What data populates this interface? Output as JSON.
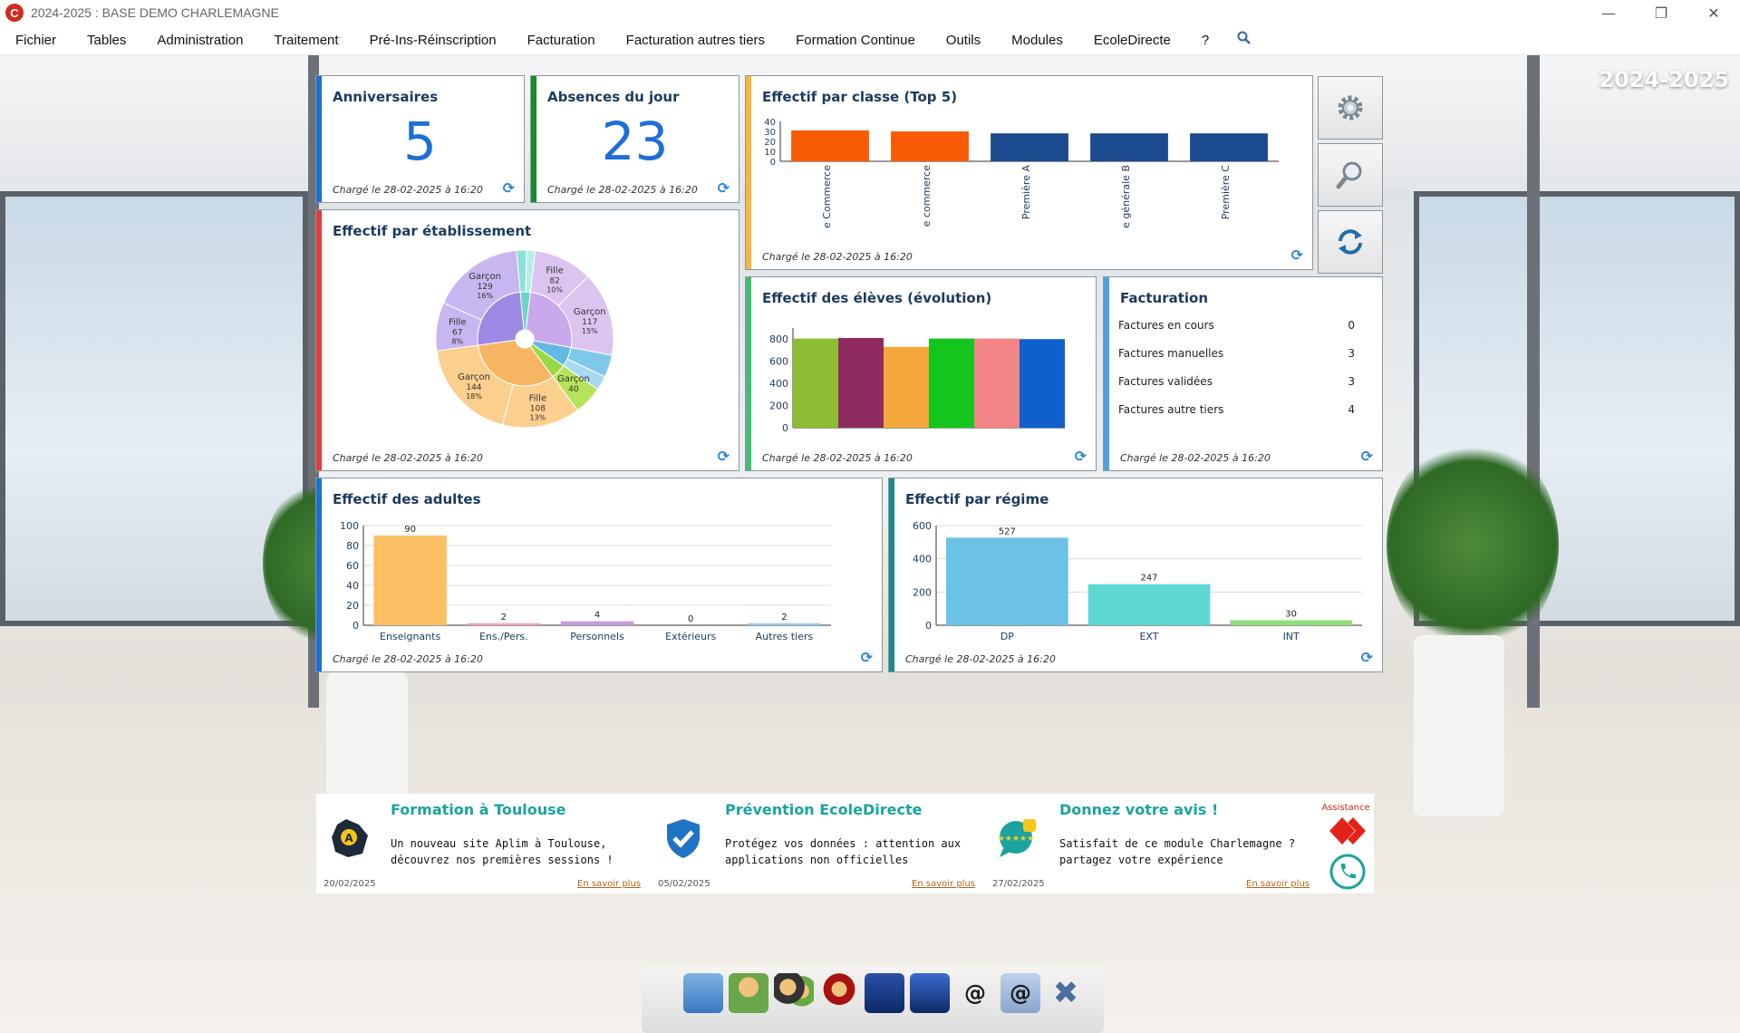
{
  "window": {
    "title": "2024-2025  :  BASE DEMO CHARLEMAGNE",
    "logo_letter": "C",
    "controls": {
      "minimize": "—",
      "restore": "❐",
      "close": "✕"
    }
  },
  "menu": [
    "Fichier",
    "Tables",
    "Administration",
    "Traitement",
    "Pré-Ins-Réinscription",
    "Facturation",
    "Facturation autres tiers",
    "Formation Continue",
    "Outils",
    "Modules",
    "EcoleDirecte",
    "?"
  ],
  "year_label": "2024-2025",
  "loaded_text": "Chargé le 28-02-2025 à 16:20",
  "refresh_glyph": "⟳",
  "widgets": {
    "anniversaires": {
      "title": "Anniversaires",
      "value": "5",
      "accent": "#1f6fd1"
    },
    "absences": {
      "title": "Absences du jour",
      "value": "23",
      "accent": "#1a8a2a"
    },
    "effectif_classe": {
      "title": "Effectif par classe (Top 5)",
      "accent": "#f6b73c"
    },
    "effectif_etab": {
      "title": "Effectif par établissement",
      "accent": "#e23c3c"
    },
    "evolution": {
      "title": "Effectif des élèves (évolution)",
      "accent": "#3fbf6f"
    },
    "facturation": {
      "title": "Facturation",
      "accent": "#4aa3e0",
      "rows": [
        {
          "label": "Factures en cours",
          "value": "0"
        },
        {
          "label": "Factures manuelles",
          "value": "3"
        },
        {
          "label": "Factures validées",
          "value": "3"
        },
        {
          "label": "Factures autre tiers",
          "value": "4"
        }
      ]
    },
    "adultes": {
      "title": "Effectif des adultes",
      "accent": "#1f6fd1"
    },
    "regime": {
      "title": "Effectif par régime",
      "accent": "#1a8a8a"
    }
  },
  "chart_data": [
    {
      "type": "bar",
      "title": "Effectif par classe (Top 5)",
      "categories": [
        "e Commerce",
        "e commerce",
        "Première A",
        "e générale B",
        "Première C"
      ],
      "values": [
        31,
        30,
        28,
        28,
        28
      ],
      "colors": [
        "#f95a04",
        "#f95a04",
        "#1c4a8e",
        "#1c4a8e",
        "#1c4a8e"
      ],
      "ylim": [
        0,
        40
      ],
      "yticks": [
        0,
        10,
        20,
        30,
        40
      ]
    },
    {
      "type": "bar",
      "title": "Effectif des élèves (évolution)",
      "categories": [
        "",
        "",
        "",
        "",
        "",
        ""
      ],
      "values": [
        805,
        810,
        730,
        805,
        805,
        800
      ],
      "colors": [
        "#8dbd32",
        "#8f2b5e",
        "#f5a83a",
        "#14c51e",
        "#f28485",
        "#0f5fcc"
      ],
      "ylim": [
        0,
        900
      ],
      "yticks": [
        0,
        200,
        400,
        600,
        800
      ]
    },
    {
      "type": "bar",
      "title": "Effectif des adultes",
      "categories": [
        "Enseignants",
        "Ens./Pers.",
        "Personnels",
        "Extérieurs",
        "Autres tiers"
      ],
      "values": [
        90,
        2,
        4,
        0,
        2
      ],
      "colors": [
        "#fbc164",
        "#f3a2b8",
        "#c89be0",
        "#9ec9ea",
        "#8fd1ee"
      ],
      "ylim": [
        0,
        100
      ],
      "yticks": [
        0,
        20,
        40,
        60,
        80,
        100
      ]
    },
    {
      "type": "bar",
      "title": "Effectif par régime",
      "categories": [
        "DP",
        "EXT",
        "INT"
      ],
      "values": [
        527,
        247,
        30
      ],
      "colors": [
        "#6cc2e6",
        "#5ed7d3",
        "#8fe07a"
      ],
      "ylim": [
        0,
        600
      ],
      "yticks": [
        0,
        200,
        400,
        600
      ]
    },
    {
      "type": "pie",
      "title": "Effectif par établissement",
      "outer": [
        {
          "label": "Fille",
          "value": 82,
          "pct": "10%",
          "color": "#dcc4f0"
        },
        {
          "label": "Garçon",
          "value": 117,
          "pct": "15%",
          "color": "#dcc4f0"
        },
        {
          "label": "",
          "value": 31,
          "pct": "4%",
          "color": "#7ec9ea"
        },
        {
          "label": "",
          "value": 20,
          "pct": "",
          "color": "#a7d9f0"
        },
        {
          "label": "Garçon",
          "value": 40,
          "pct": "",
          "color": "#b5e35a"
        },
        {
          "label": "Fille",
          "value": 108,
          "pct": "13%",
          "color": "#fbcf8e"
        },
        {
          "label": "Garçon",
          "value": 144,
          "pct": "18%",
          "color": "#fbcf8e"
        },
        {
          "label": "Fille",
          "value": 67,
          "pct": "8%",
          "color": "#c7b6ef"
        },
        {
          "label": "Garçon",
          "value": 129,
          "pct": "16%",
          "color": "#c7b6ef"
        },
        {
          "label": "",
          "value": 14,
          "pct": "",
          "color": "#8de0d6"
        },
        {
          "label": "",
          "value": 12,
          "pct": "",
          "color": "#b5eee6"
        }
      ],
      "inner": [
        {
          "value": 199,
          "color": "#c9a8ec"
        },
        {
          "value": 51,
          "color": "#63b9e4"
        },
        {
          "value": 40,
          "color": "#9ad944"
        },
        {
          "value": 252,
          "color": "#f7b563"
        },
        {
          "value": 196,
          "color": "#9c8ae6"
        },
        {
          "value": 26,
          "color": "#6cd3c8"
        }
      ]
    }
  ],
  "side_buttons": [
    "gear-icon",
    "search-icon",
    "sync-icon"
  ],
  "news": [
    {
      "title": "Formation à Toulouse",
      "text": "Un nouveau site Aplim à Toulouse, découvrez nos premières sessions !",
      "date": "20/02/2025",
      "link": "En savoir plus"
    },
    {
      "title": "Prévention EcoleDirecte",
      "text": "Protégez vos données : attention aux applications non officielles",
      "date": "05/02/2025",
      "link": "En savoir plus"
    },
    {
      "title": "Donnez votre avis !",
      "text": "Satisfait de ce module Charlemagne ? partagez votre expérience",
      "date": "27/02/2025",
      "link": "En savoir plus"
    }
  ],
  "assistance": {
    "label": "Assistance"
  },
  "dock": [
    "folder-icon",
    "user-icon",
    "parents-icon",
    "group-icon",
    "phone-device-icon",
    "phones-icon",
    "at-icon",
    "at-mail-icon",
    "close-x-icon"
  ]
}
